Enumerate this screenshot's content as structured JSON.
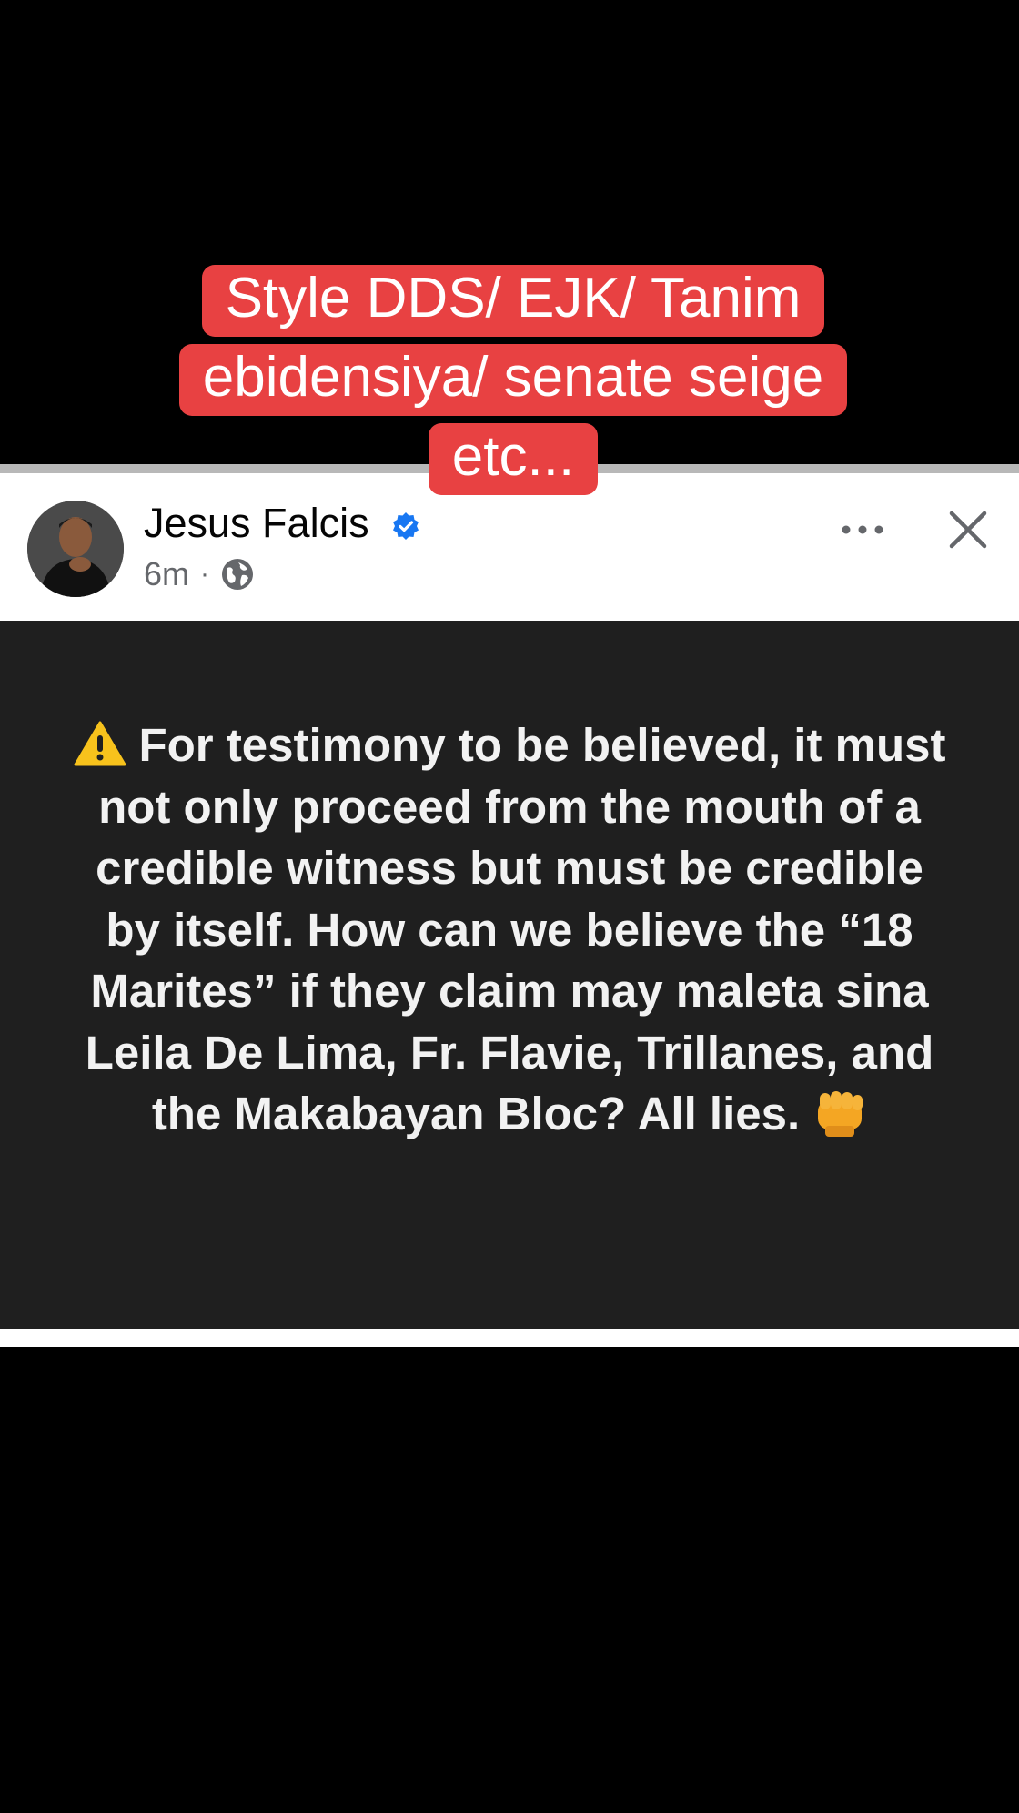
{
  "caption": {
    "lines": [
      "Style DDS/ EJK/ Tanim",
      "ebidensiya/ senate seige",
      "etc..."
    ]
  },
  "post": {
    "author": "Jesus Falcis",
    "time": "6m",
    "separator": "·",
    "body": "For testimony to be believed, it must not only proceed from the mouth of a credible witness but must be credible by itself. How can we believe the “18 Marites” if they claim may maleta sina Leila De Lima, Fr. Flavie, Trillanes, and the Makabayan Bloc? All lies.",
    "background_color": "#1f1f1f",
    "text_color": "#f2f2f2"
  },
  "icons": {
    "verified": "verified-badge-icon",
    "audience": "globe-icon",
    "more": "more-options-icon",
    "close": "close-icon",
    "warning": "warning-icon",
    "fist": "oncoming-fist-icon"
  },
  "colors": {
    "caption_bg": "#e84142",
    "verified_blue": "#1877f2",
    "meta_gray": "#65676b"
  }
}
